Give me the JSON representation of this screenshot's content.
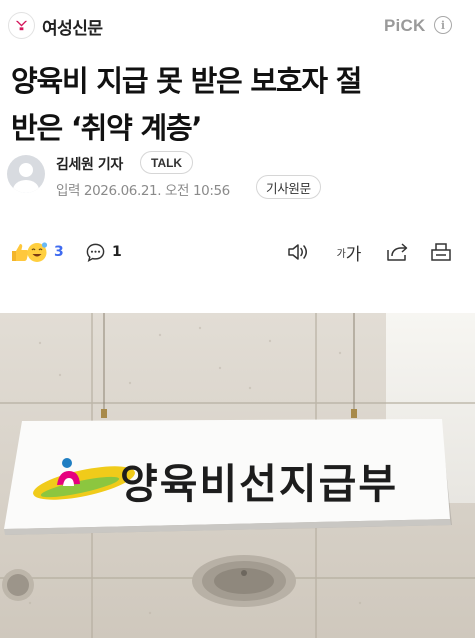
{
  "press": {
    "name": "여성신문",
    "logo_icon": "press-logo-icon",
    "logo_color": "#d4145a"
  },
  "header": {
    "pick_label": "PiCK",
    "info_icon": "info-icon",
    "info_glyph": "i"
  },
  "article": {
    "title_line1": "양육비 지급 못 받은 보호자 절",
    "title_line2": "반은 ‘취약 계층’"
  },
  "byline": {
    "reporter": "김세원 기자",
    "talk_label": "TALK",
    "date": "입력 2026.06.21. 오전 10:56",
    "origin_label": "기사원문"
  },
  "actions": {
    "reaction_icons": [
      "like-hand-icon",
      "emoji-face-icon"
    ],
    "reaction_count": "3",
    "comment_icon": "comment-icon",
    "comment_count": "1",
    "tts_icon": "speaker-icon",
    "font_small": "가",
    "font_big": "가",
    "share_icon": "share-icon",
    "print_icon": "print-icon",
    "accent_color": "#3f6bf0"
  },
  "photo": {
    "sign_text": "양육비선지급부"
  }
}
